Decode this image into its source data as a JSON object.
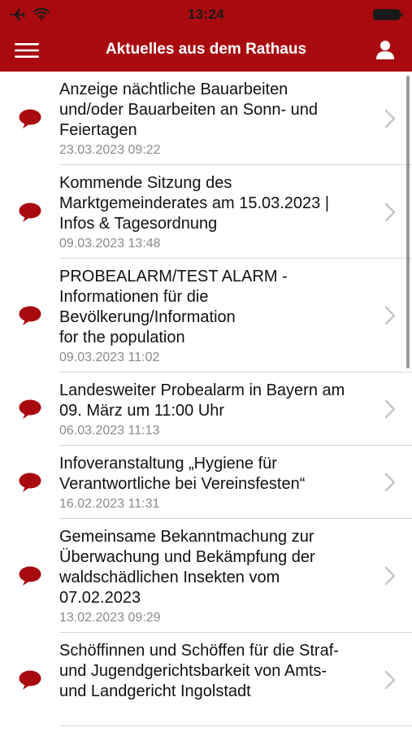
{
  "status_bar": {
    "time": "13:24",
    "airplane_icon": "airplane-icon",
    "wifi_icon": "wifi-icon",
    "battery_icon": "battery-icon"
  },
  "header": {
    "title": "Aktuelles aus dem Rathaus",
    "menu_icon": "hamburger-menu-icon",
    "user_icon": "user-profile-icon",
    "background_color": "#a80a10"
  },
  "news": [
    {
      "title_lines": [
        "Anzeige nächtliche Bauarbeiten",
        "und/oder Bauarbeiten an Sonn- und",
        "Feiertagen"
      ],
      "date": "23.03.2023 09:22"
    },
    {
      "title_lines": [
        "Kommende Sitzung des",
        "Marktgemeinderates am 15.03.2023 |",
        "Infos & Tagesordnung"
      ],
      "date": "09.03.2023 13:48"
    },
    {
      "title_lines": [
        "PROBEALARM/TEST ALARM -",
        "Informationen für die",
        "Bevölkerung/Information",
        "for the population"
      ],
      "date": "09.03.2023 11:02"
    },
    {
      "title_lines": [
        "Landesweiter Probealarm in Bayern am",
        "09. März um 11:00 Uhr"
      ],
      "date": "06.03.2023 11:13"
    },
    {
      "title_lines": [
        "Infoveranstaltung „Hygiene für",
        "Verantwortliche bei Vereinsfesten“"
      ],
      "date": "16.02.2023 11:31"
    },
    {
      "title_lines": [
        "Gemeinsame Bekanntmachung zur",
        "Überwachung und Bekämpfung der",
        "waldschädlichen Insekten vom",
        "07.02.2023"
      ],
      "date": "13.02.2023 09:29"
    },
    {
      "title_lines": [
        "Schöffinnen und Schöffen für die Straf-",
        "und Jugendgerichtsbarkeit von Amts-",
        "und Landgericht Ingolstadt"
      ],
      "date": ""
    }
  ],
  "colors": {
    "accent": "#a80a10",
    "bubble": "#a80a10",
    "date_text": "#8a8a8a",
    "separator": "#d4d4d4",
    "chevron": "#c4c4c4"
  }
}
